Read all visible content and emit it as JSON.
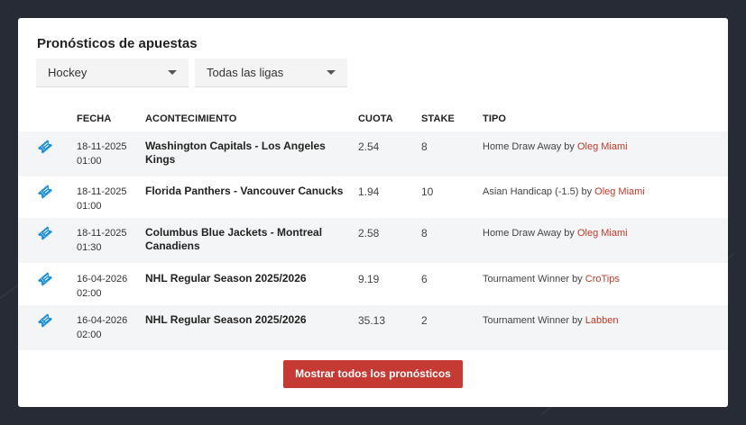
{
  "title": "Pronósticos de apuestas",
  "filters": {
    "sport": "Hockey",
    "league": "Todas las ligas"
  },
  "columns": {
    "fecha": "FECHA",
    "acontecimiento": "ACONTECIMIENTO",
    "cuota": "CUOTA",
    "stake": "STAKE",
    "tipo": "TIPO"
  },
  "by_word": "by",
  "rows": [
    {
      "date": "18-11-2025",
      "time": "01:00",
      "event": "Washington Capitals - Los Angeles Kings",
      "odds": "2.54",
      "stake": "8",
      "type": "Home Draw Away",
      "tipster": "Oleg Miami"
    },
    {
      "date": "18-11-2025",
      "time": "01:00",
      "event": "Florida Panthers - Vancouver Canucks",
      "odds": "1.94",
      "stake": "10",
      "type": "Asian Handicap (-1.5)",
      "tipster": "Oleg Miami"
    },
    {
      "date": "18-11-2025",
      "time": "01:30",
      "event": "Columbus Blue Jackets - Montreal Canadiens",
      "odds": "2.58",
      "stake": "8",
      "type": "Home Draw Away",
      "tipster": "Oleg Miami"
    },
    {
      "date": "16-04-2026",
      "time": "02:00",
      "event": "NHL Regular Season 2025/2026",
      "odds": "9.19",
      "stake": "6",
      "type": "Tournament Winner",
      "tipster": "CroTips"
    },
    {
      "date": "16-04-2026",
      "time": "02:00",
      "event": "NHL Regular Season 2025/2026",
      "odds": "35.13",
      "stake": "2",
      "type": "Tournament Winner",
      "tipster": "Labben"
    }
  ],
  "show_all_label": "Mostrar todos los pronósticos",
  "colors": {
    "accent": "#c53a33",
    "ticket": "#1e90d6",
    "tipster": "#c0392b"
  }
}
